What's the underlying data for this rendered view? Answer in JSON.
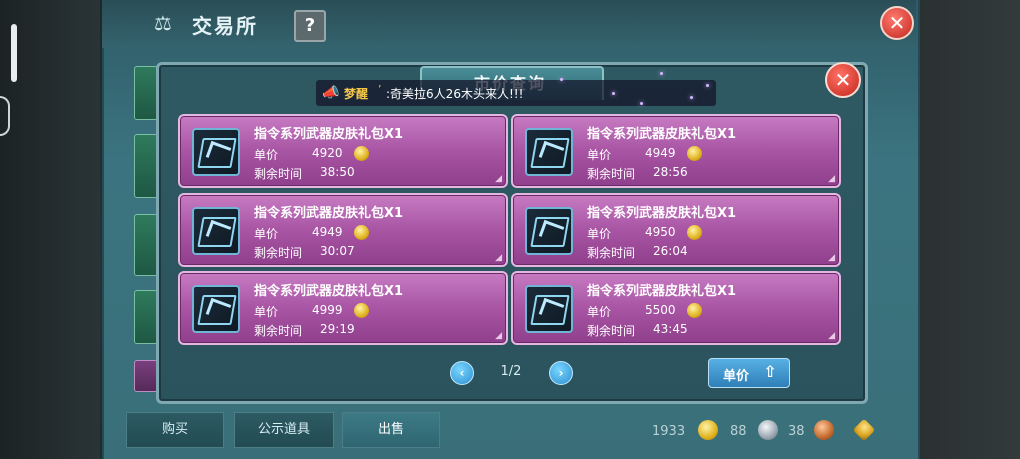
{
  "window": {
    "title": "交易所",
    "help_label": "?",
    "close_label": "✕"
  },
  "broadcast": {
    "name": "梦醒",
    "separator": "’",
    "message": ":奇美拉6人26木头来人!!!"
  },
  "dialog": {
    "title": "市价查询",
    "close_label": "✕"
  },
  "items": [
    {
      "name": "指令系列武器皮肤礼包X1",
      "price_label": "单价",
      "price": "4920",
      "time_label": "剩余时间",
      "time": "38:50"
    },
    {
      "name": "指令系列武器皮肤礼包X1",
      "price_label": "单价",
      "price": "4949",
      "time_label": "剩余时间",
      "time": "28:56"
    },
    {
      "name": "指令系列武器皮肤礼包X1",
      "price_label": "单价",
      "price": "4949",
      "time_label": "剩余时间",
      "time": "30:07"
    },
    {
      "name": "指令系列武器皮肤礼包X1",
      "price_label": "单价",
      "price": "4950",
      "time_label": "剩余时间",
      "time": "26:04"
    },
    {
      "name": "指令系列武器皮肤礼包X1",
      "price_label": "单价",
      "price": "4999",
      "time_label": "剩余时间",
      "time": "29:19"
    },
    {
      "name": "指令系列武器皮肤礼包X1",
      "price_label": "单价",
      "price": "5500",
      "time_label": "剩余时间",
      "time": "43:45"
    }
  ],
  "pager": {
    "label": "1/2",
    "prev": "‹",
    "next": "›"
  },
  "sort": {
    "label": "单价",
    "arrow": "⇧"
  },
  "tabs": [
    {
      "label": "购买"
    },
    {
      "label": "公示道具"
    },
    {
      "label": "出售"
    }
  ],
  "currency": {
    "gold": "1933",
    "silver": "88",
    "bronze": "38"
  },
  "icons": {
    "window": "scale-icon",
    "coin": "gold-coin-icon",
    "broadcast": "horn-icon"
  },
  "colors": {
    "card_top": "#c77bc2",
    "card_bottom": "#8f3f8c",
    "dialog_bg": "#2e5963",
    "accent_blue": "#2f7fb8"
  }
}
